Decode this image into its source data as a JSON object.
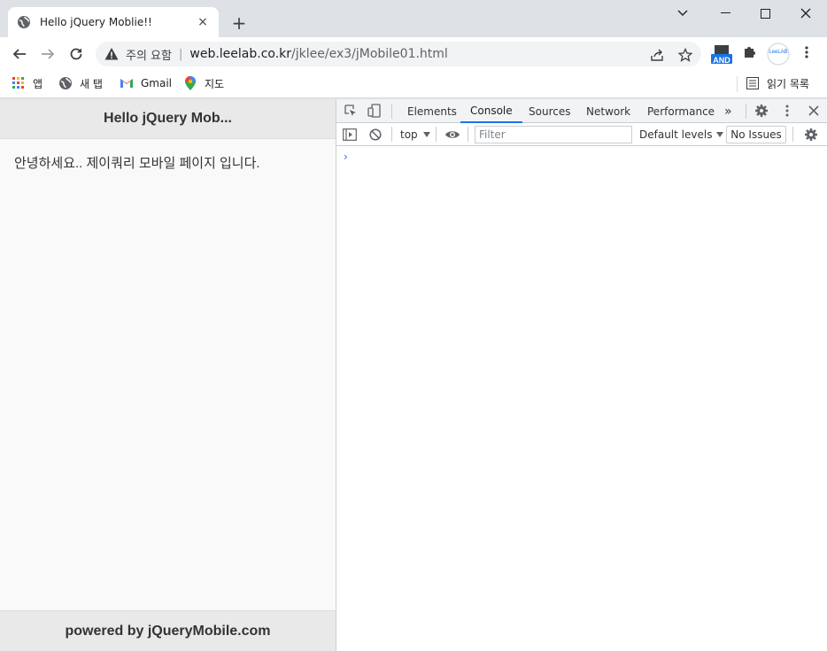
{
  "browser": {
    "tab_title": "Hello jQuery Moblie!!",
    "tab_close": "×",
    "new_tab": "+",
    "security_text": "주의 요함",
    "url_host": "web.leelab.co.kr",
    "url_path": "/jklee/ex3/jMobile01.html",
    "ext_and_label": "AND",
    "ext_leelab_label": "LeeLAB"
  },
  "bookmarks": {
    "apps": "앱",
    "new_tab": "새 탭",
    "gmail": "Gmail",
    "maps": "지도",
    "reading_list": "읽기 목록"
  },
  "page": {
    "header_title": "Hello jQuery Mob...",
    "content_text": "안녕하세요.. 제이쿼리 모바일 페이지 입니다.",
    "footer_text": "powered by jQueryMobile.com"
  },
  "devtools": {
    "tabs": [
      "Elements",
      "Console",
      "Sources",
      "Network",
      "Performance"
    ],
    "active_tab": "Console",
    "more_tabs": "»",
    "context": "top",
    "filter_placeholder": "Filter",
    "levels": "Default levels",
    "issues": "No Issues",
    "prompt": "›"
  },
  "colors": {
    "accent": "#1a73e8",
    "chrome_bg": "#dee1e6",
    "jq_bar": "#e9e9e9"
  }
}
